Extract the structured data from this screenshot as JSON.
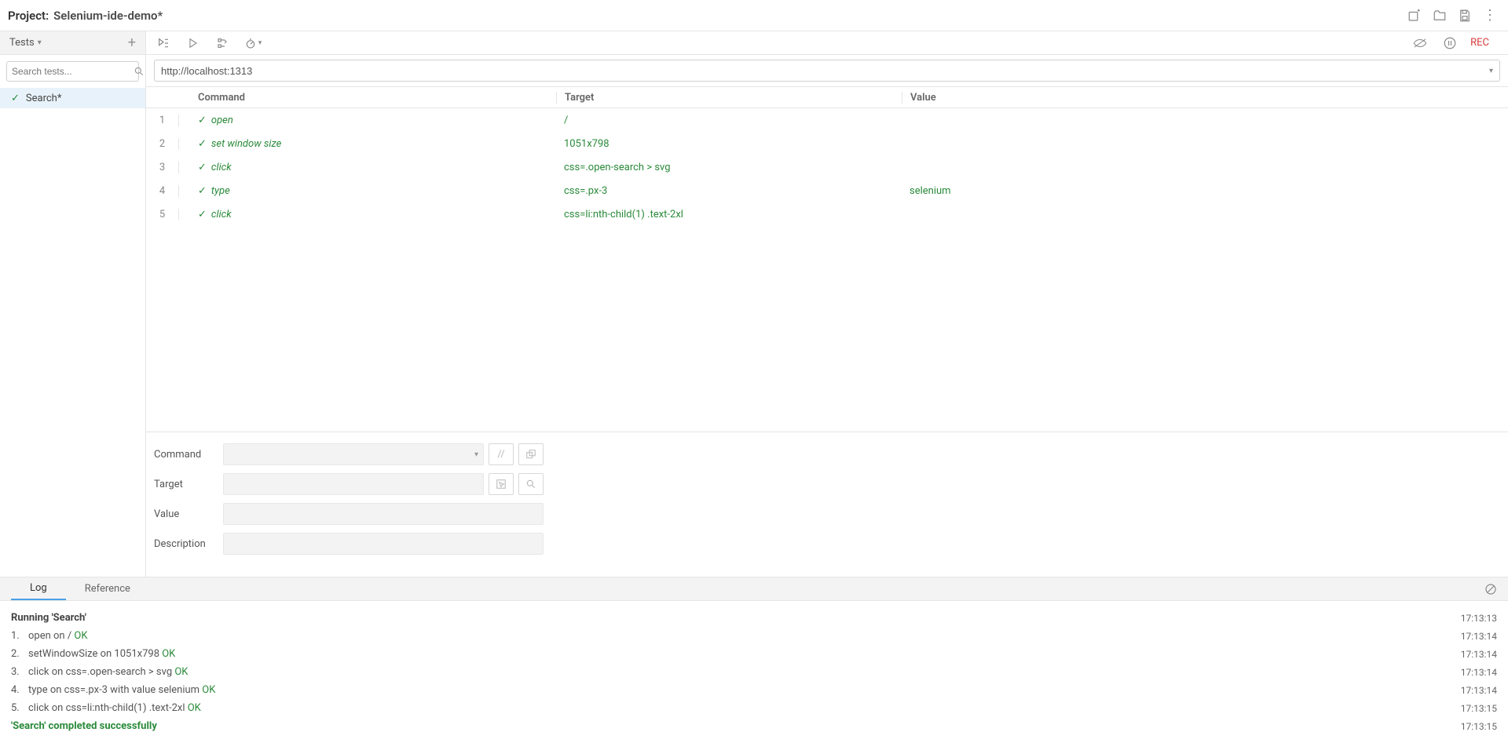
{
  "project": {
    "label": "Project:",
    "name": "Selenium-ide-demo*"
  },
  "sidebar": {
    "tab_label": "Tests",
    "search_placeholder": "Search tests...",
    "tests": [
      {
        "name": "Search*",
        "passed": true
      }
    ]
  },
  "url": "http://localhost:1313",
  "columns": {
    "command": "Command",
    "target": "Target",
    "value": "Value"
  },
  "commands": [
    {
      "n": "1",
      "cmd": "open",
      "target": "/",
      "value": ""
    },
    {
      "n": "2",
      "cmd": "set window size",
      "target": "1051x798",
      "value": ""
    },
    {
      "n": "3",
      "cmd": "click",
      "target": "css=.open-search > svg",
      "value": ""
    },
    {
      "n": "4",
      "cmd": "type",
      "target": "css=.px-3",
      "value": "selenium"
    },
    {
      "n": "5",
      "cmd": "click",
      "target": "css=li:nth-child(1) .text-2xl",
      "value": ""
    }
  ],
  "editor": {
    "command_label": "Command",
    "target_label": "Target",
    "value_label": "Value",
    "description_label": "Description"
  },
  "bottom_tabs": {
    "log": "Log",
    "reference": "Reference"
  },
  "log": [
    {
      "type": "header",
      "text": "Running 'Search'",
      "time": "17:13:13"
    },
    {
      "type": "step",
      "n": "1.",
      "text": "open on / ",
      "ok": "OK",
      "time": "17:13:14"
    },
    {
      "type": "step",
      "n": "2.",
      "text": "setWindowSize on 1051x798 ",
      "ok": "OK",
      "time": "17:13:14"
    },
    {
      "type": "step",
      "n": "3.",
      "text": "click on css=.open-search > svg ",
      "ok": "OK",
      "time": "17:13:14"
    },
    {
      "type": "step",
      "n": "4.",
      "text": "type on css=.px-3 with value selenium ",
      "ok": "OK",
      "time": "17:13:14"
    },
    {
      "type": "step",
      "n": "5.",
      "text": "click on css=li:nth-child(1) .text-2xl ",
      "ok": "OK",
      "time": "17:13:15"
    },
    {
      "type": "done",
      "text": "'Search' completed successfully",
      "time": "17:13:15"
    }
  ]
}
